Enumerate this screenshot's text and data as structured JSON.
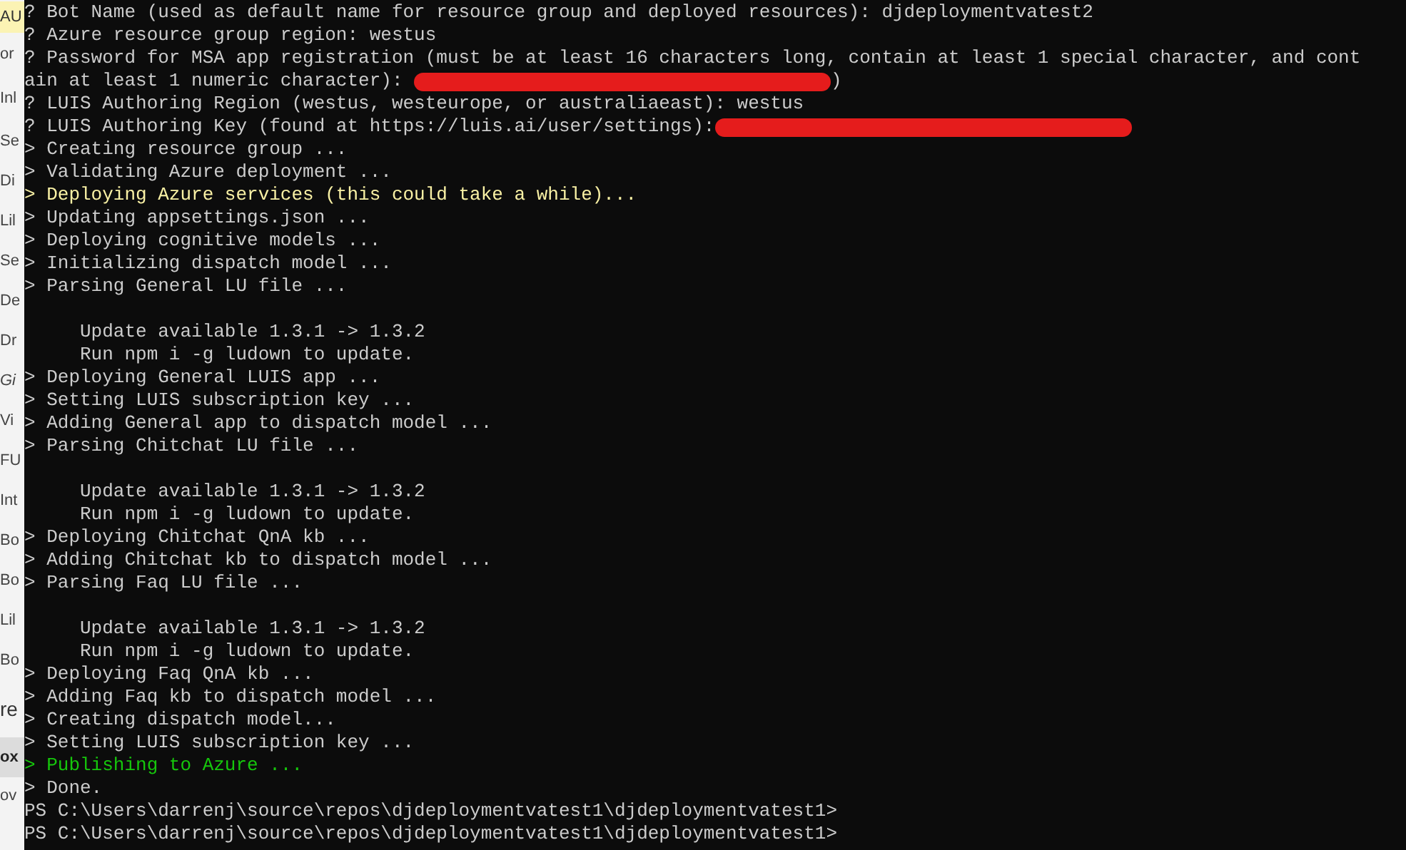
{
  "background_window": {
    "fragments": [
      {
        "text": "AU",
        "kind": "highlight"
      },
      {
        "text": "or",
        "kind": "plain"
      },
      {
        "text": "Inl",
        "kind": "plain"
      },
      {
        "text": "Se",
        "kind": "plain"
      },
      {
        "text": "Di",
        "kind": "plain"
      },
      {
        "text": "Lil",
        "kind": "plain"
      },
      {
        "text": "Se",
        "kind": "plain"
      },
      {
        "text": "De",
        "kind": "plain"
      },
      {
        "text": "Dr",
        "kind": "plain"
      },
      {
        "text": "Gi",
        "kind": "italic"
      },
      {
        "text": "Vi",
        "kind": "plain"
      },
      {
        "text": "FU",
        "kind": "plain"
      },
      {
        "text": "Int",
        "kind": "plain"
      },
      {
        "text": "Bo",
        "kind": "plain"
      },
      {
        "text": "Bo",
        "kind": "plain"
      },
      {
        "text": "Lil",
        "kind": "plain"
      },
      {
        "text": "Bo",
        "kind": "plain"
      },
      {
        "text": "re",
        "kind": "large"
      },
      {
        "text": "ox",
        "kind": "bold"
      },
      {
        "text": "ov",
        "kind": "plain"
      }
    ]
  },
  "terminal": {
    "lines": [
      {
        "kind": "text",
        "text": "? Bot Name (used as default name for resource group and deployed resources): djdeploymentvatest2"
      },
      {
        "kind": "text",
        "text": "? Azure resource group region: westus"
      },
      {
        "kind": "text",
        "text": "? Password for MSA app registration (must be at least 16 characters long, contain at least 1 special character, and cont"
      },
      {
        "kind": "redacted",
        "text": "ain at least 1 numeric character): ",
        "tail": ")"
      },
      {
        "kind": "text",
        "text": "? LUIS Authoring Region (westus, westeurope, or australiaeast): westus"
      },
      {
        "kind": "redacted",
        "text": "? LUIS Authoring Key (found at https://luis.ai/user/settings):"
      },
      {
        "kind": "text",
        "text": "> Creating resource group ..."
      },
      {
        "kind": "text",
        "text": "> Validating Azure deployment ..."
      },
      {
        "kind": "warning",
        "text": "> Deploying Azure services (this could take a while)..."
      },
      {
        "kind": "text",
        "text": "> Updating appsettings.json ..."
      },
      {
        "kind": "text",
        "text": "> Deploying cognitive models ..."
      },
      {
        "kind": "text",
        "text": "> Initializing dispatch model ..."
      },
      {
        "kind": "text",
        "text": "> Parsing General LU file ..."
      },
      {
        "kind": "blank"
      },
      {
        "kind": "text",
        "text": "     Update available 1.3.1 -> 1.3.2"
      },
      {
        "kind": "text",
        "text": "     Run npm i -g ludown to update."
      },
      {
        "kind": "text",
        "text": "> Deploying General LUIS app ..."
      },
      {
        "kind": "text",
        "text": "> Setting LUIS subscription key ..."
      },
      {
        "kind": "text",
        "text": "> Adding General app to dispatch model ..."
      },
      {
        "kind": "text",
        "text": "> Parsing Chitchat LU file ..."
      },
      {
        "kind": "blank"
      },
      {
        "kind": "text",
        "text": "     Update available 1.3.1 -> 1.3.2"
      },
      {
        "kind": "text",
        "text": "     Run npm i -g ludown to update."
      },
      {
        "kind": "text",
        "text": "> Deploying Chitchat QnA kb ..."
      },
      {
        "kind": "text",
        "text": "> Adding Chitchat kb to dispatch model ..."
      },
      {
        "kind": "text",
        "text": "> Parsing Faq LU file ..."
      },
      {
        "kind": "blank"
      },
      {
        "kind": "text",
        "text": "     Update available 1.3.1 -> 1.3.2"
      },
      {
        "kind": "text",
        "text": "     Run npm i -g ludown to update."
      },
      {
        "kind": "text",
        "text": "> Deploying Faq QnA kb ..."
      },
      {
        "kind": "text",
        "text": "> Adding Faq kb to dispatch model ..."
      },
      {
        "kind": "text",
        "text": "> Creating dispatch model..."
      },
      {
        "kind": "text",
        "text": "> Setting LUIS subscription key ..."
      },
      {
        "kind": "success",
        "text": "> Publishing to Azure ..."
      },
      {
        "kind": "text",
        "text": "> Done."
      },
      {
        "kind": "text",
        "text": "PS C:\\Users\\darrenj\\source\\repos\\djdeploymentvatest1\\djdeploymentvatest1>"
      },
      {
        "kind": "text",
        "text": "PS C:\\Users\\darrenj\\source\\repos\\djdeploymentvatest1\\djdeploymentvatest1>"
      }
    ]
  }
}
